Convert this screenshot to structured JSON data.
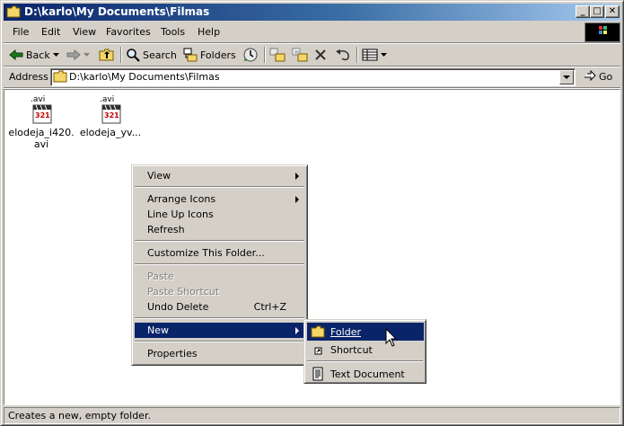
{
  "window": {
    "title": "D:\\karlo\\My Documents\\Filmas",
    "controls": {
      "minimize": "_",
      "maximize": "□",
      "close": "✕"
    }
  },
  "menubar": {
    "items": [
      "File",
      "Edit",
      "View",
      "Favorites",
      "Tools",
      "Help"
    ]
  },
  "toolbar": {
    "back_label": "Back",
    "search_label": "Search",
    "folders_label": "Folders"
  },
  "address": {
    "label": "Address",
    "value": "D:\\karlo\\My Documents\\Filmas",
    "go_label": "Go"
  },
  "files": [
    {
      "badge": ".avi",
      "tag": "321",
      "name": "elodeja_i420.avi"
    },
    {
      "badge": ".avi",
      "tag": "321",
      "name": "elodeja_yv..."
    }
  ],
  "context_menu": {
    "view": "View",
    "arrange_icons": "Arrange Icons",
    "line_up_icons": "Line Up Icons",
    "refresh": "Refresh",
    "customize": "Customize This Folder...",
    "paste": "Paste",
    "paste_shortcut": "Paste Shortcut",
    "undo_delete": "Undo Delete",
    "undo_shortcut": "Ctrl+Z",
    "new": "New",
    "properties": "Properties"
  },
  "submenu": {
    "folder": "Folder",
    "shortcut": "Shortcut",
    "text_document": "Text Document"
  },
  "status": {
    "text": "Creates a new, empty folder."
  },
  "colors": {
    "title_gradient_start": "#0a246a",
    "title_gradient_end": "#a6caf0",
    "selection": "#0a246a",
    "face": "#d4d0c8"
  },
  "icons": [
    "folder-icon",
    "back-arrow-icon",
    "forward-arrow-icon",
    "up-folder-icon",
    "search-icon",
    "folders-icon",
    "history-icon",
    "move-to-icon",
    "copy-to-icon",
    "delete-icon",
    "undo-icon",
    "views-icon",
    "go-arrow-icon",
    "shortcut-icon",
    "text-document-icon",
    "mouse-cursor-icon"
  ]
}
